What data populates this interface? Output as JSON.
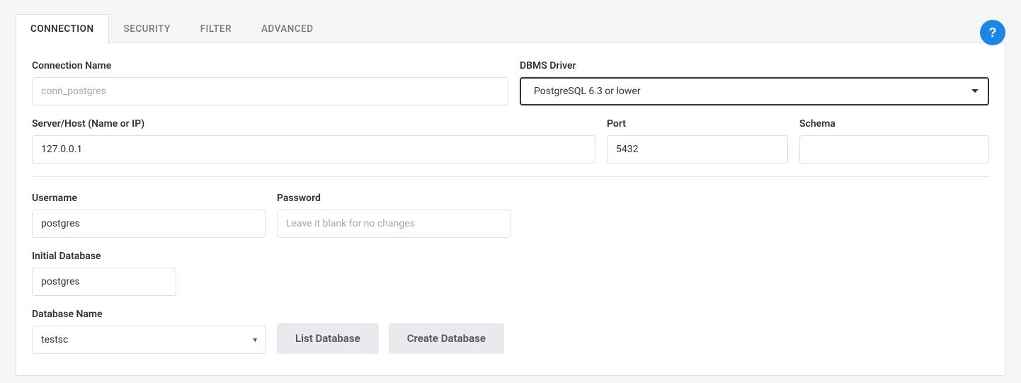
{
  "tabs": {
    "connection": "CONNECTION",
    "security": "SECURITY",
    "filter": "FILTER",
    "advanced": "ADVANCED"
  },
  "help": "?",
  "labels": {
    "connection_name": "Connection Name",
    "dbms_driver": "DBMS Driver",
    "server_host": "Server/Host (Name or IP)",
    "port": "Port",
    "schema": "Schema",
    "username": "Username",
    "password": "Password",
    "initial_database": "Initial Database",
    "database_name": "Database Name"
  },
  "values": {
    "connection_name_placeholder": "conn_postgres",
    "dbms_driver": "PostgreSQL 6.3 or lower",
    "server_host": "127.0.0.1",
    "port": "5432",
    "schema": "",
    "username": "postgres",
    "password_placeholder": "Leave it blank for no changes",
    "initial_database": "postgres",
    "database_name": "testsc"
  },
  "buttons": {
    "list_database": "List Database",
    "create_database": "Create Database"
  }
}
